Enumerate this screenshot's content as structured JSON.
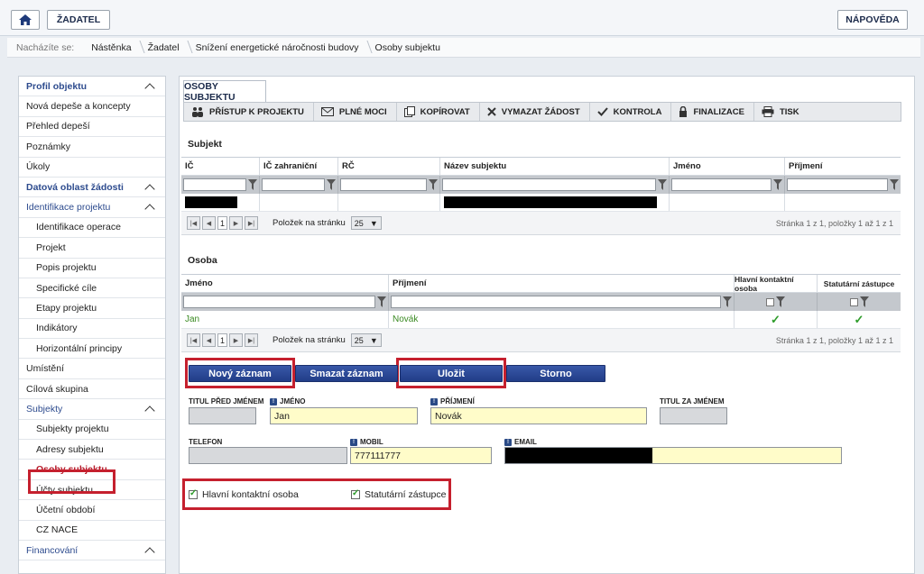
{
  "topbar": {
    "zadatel": "ŽADATEL",
    "help": "NÁPOVĚDA"
  },
  "breadcrumb": {
    "lead": "Nacházíte se:",
    "items": [
      "Nástěnka",
      "Žadatel",
      "Snížení energetické náročnosti budovy",
      "Osoby subjektu"
    ]
  },
  "sidebar": {
    "items": [
      {
        "label": "Profil objektu",
        "type": "section"
      },
      {
        "label": "Nová depeše a koncepty",
        "type": "item"
      },
      {
        "label": "Přehled depeší",
        "type": "item"
      },
      {
        "label": "Poznámky",
        "type": "item"
      },
      {
        "label": "Úkoly",
        "type": "item"
      },
      {
        "label": "Datová oblast žádosti",
        "type": "section"
      },
      {
        "label": "Identifikace projektu",
        "type": "sub"
      },
      {
        "label": "Identifikace operace",
        "type": "child"
      },
      {
        "label": "Projekt",
        "type": "child"
      },
      {
        "label": "Popis projektu",
        "type": "child"
      },
      {
        "label": "Specifické cíle",
        "type": "child"
      },
      {
        "label": "Etapy projektu",
        "type": "child"
      },
      {
        "label": "Indikátory",
        "type": "child"
      },
      {
        "label": "Horizontální principy",
        "type": "child"
      },
      {
        "label": "Umístění",
        "type": "item"
      },
      {
        "label": "Cílová skupina",
        "type": "item"
      },
      {
        "label": "Subjekty",
        "type": "sub"
      },
      {
        "label": "Subjekty projektu",
        "type": "child"
      },
      {
        "label": "Adresy subjektu",
        "type": "child"
      },
      {
        "label": "Osoby subjektu",
        "type": "active"
      },
      {
        "label": "Účty subjektu",
        "type": "child"
      },
      {
        "label": "Účetní období",
        "type": "child"
      },
      {
        "label": "CZ NACE",
        "type": "child"
      },
      {
        "label": "Financování",
        "type": "sub"
      }
    ]
  },
  "main": {
    "tab": "OSOBY SUBJEKTU",
    "toolbar": {
      "access": "PŘÍSTUP K PROJEKTU",
      "power": "PLNÉ MOCI",
      "copy": "KOPÍROVAT",
      "delete": "VYMAZAT ŽÁDOST",
      "check": "KONTROLA",
      "finalize": "FINALIZACE",
      "print": "TISK"
    },
    "subjekt": {
      "title": "Subjekt",
      "headers": [
        "IČ",
        "IČ zahraniční",
        "RČ",
        "Název subjektu",
        "Jméno",
        "Příjmení"
      ]
    },
    "osoba": {
      "title": "Osoba",
      "headers": [
        "Jméno",
        "Příjmení",
        "Hlavní kontaktní osoba",
        "Statutární zástupce"
      ],
      "row": {
        "jmeno": "Jan",
        "prijmeni": "Novák"
      }
    },
    "pager": {
      "page": "1",
      "per_page_label": "Položek na stránku",
      "per_page": "25",
      "info": "Stránka 1 z 1, položky 1 až 1 z 1"
    },
    "actions": {
      "new": "Nový záznam",
      "delete": "Smazat záznam",
      "save": "Uložit",
      "cancel": "Storno"
    },
    "form": {
      "titul_pred_label": "TITUL PŘED JMÉNEM",
      "jmeno_label": "JMÉNO",
      "jmeno_value": "Jan",
      "prijmeni_label": "PŘÍJMENÍ",
      "prijmeni_value": "Novák",
      "titul_za_label": "TITUL ZA JMÉNEM",
      "telefon_label": "TELEFON",
      "mobil_label": "MOBIL",
      "mobil_value": "777111777",
      "email_label": "EMAIL",
      "hlavni_label": "Hlavní kontaktní osoba",
      "statutarni_label": "Statutární zástupce"
    }
  },
  "colors": {
    "highlight": "#c5202e",
    "button": "#2a4a96",
    "required_field": "#fffcc9"
  }
}
